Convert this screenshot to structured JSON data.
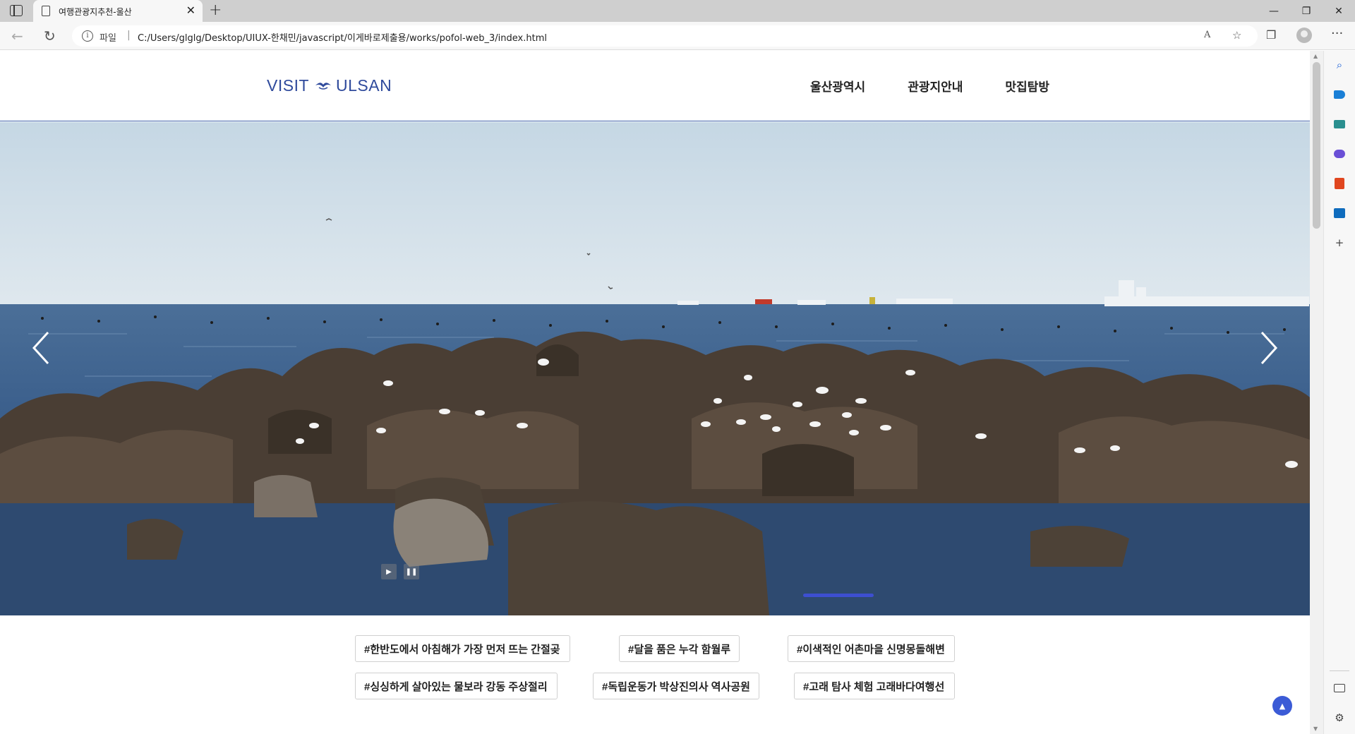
{
  "browser": {
    "tab_title": "여행관광지추천-울산",
    "tab_close": "✕",
    "new_tab": "+",
    "window": {
      "minimize": "—",
      "restore": "❐",
      "close": "✕"
    },
    "address": {
      "file_label": "파일",
      "separator": "|",
      "url": "C:/Users/glglg/Desktop/UIUX-한채민/javascript/이게바로제출용/works/pofol-web_3/index.html"
    },
    "read_aloud": "A",
    "more": "···"
  },
  "site": {
    "logo_left": "VISIT",
    "logo_right": "ULSAN",
    "nav": [
      "울산광역시",
      "관광지안내",
      "맛집탐방"
    ],
    "hashtags": [
      "#한반도에서 아침해가 가장 먼저 뜨는 간절곶",
      "#달을 품은 누각 함월루",
      "#이색적인 어촌마을 신명몽돌해변",
      "#싱싱하게 살아있는 물보라 강동 주상절리",
      "#독립운동가 박상진의사 역사공원",
      "#고래 탐사 체험 고래바다여행선"
    ],
    "slider": {
      "play": "▶",
      "pause": "❚❚",
      "active_index": 2
    },
    "colors": {
      "brand": "#2f4a9c",
      "indicator": "#3d4fd0",
      "to_top": "#3b5bd6"
    }
  },
  "icons": {
    "sidebar": [
      "search-icon",
      "tag-icon",
      "tools-icon",
      "games-icon",
      "office-icon",
      "outlook-icon",
      "add-icon",
      "hide-sidebar-icon",
      "settings-icon"
    ]
  }
}
